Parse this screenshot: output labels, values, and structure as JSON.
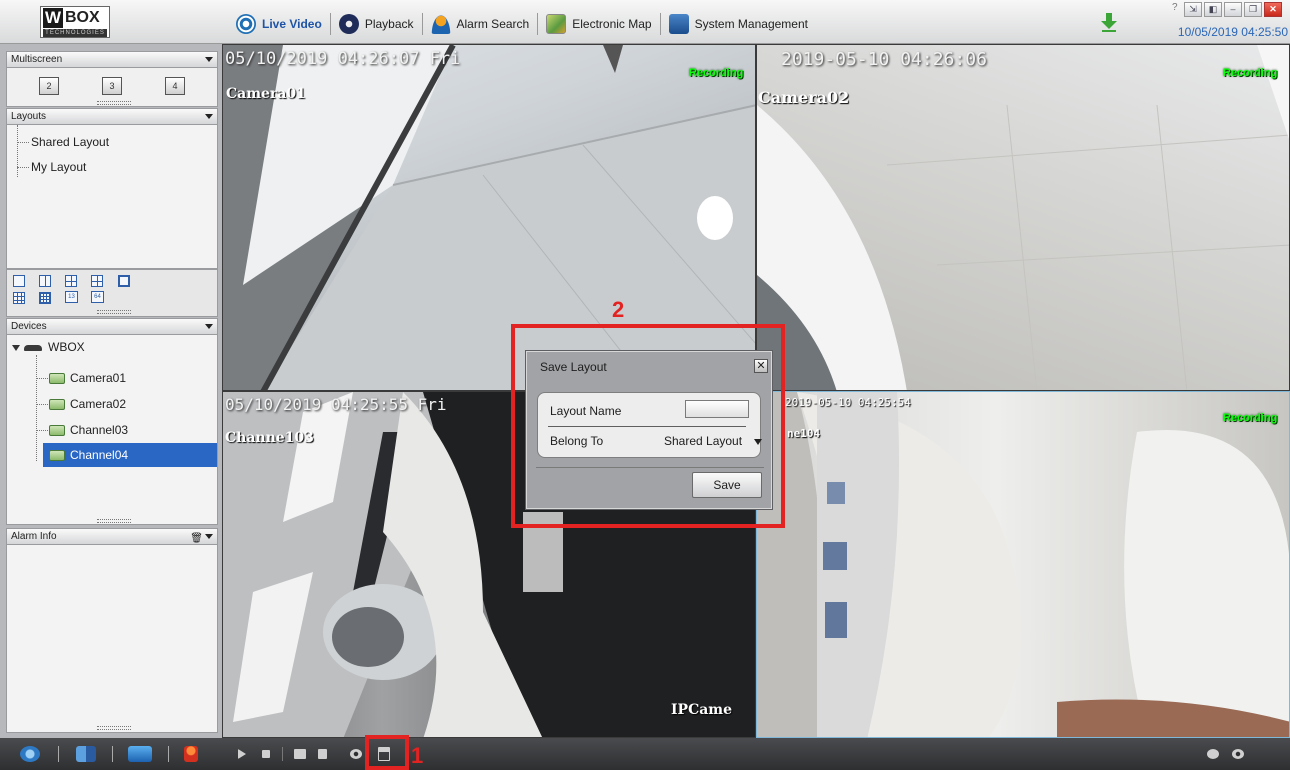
{
  "app": {
    "logo_letter": "W",
    "logo_word": "BOX",
    "logo_sub": "TECHNOLOGIES",
    "datetime": "10/05/2019 04:25:50",
    "question_mark": "?"
  },
  "nav": [
    {
      "label": "Live Video",
      "icon": "eye-icon",
      "active": true
    },
    {
      "label": "Playback",
      "icon": "playback-icon",
      "active": false
    },
    {
      "label": "Alarm Search",
      "icon": "alarm-search-icon",
      "active": false
    },
    {
      "label": "Electronic Map",
      "icon": "electronic-map-icon",
      "active": false
    },
    {
      "label": "System Management",
      "icon": "system-management-icon",
      "active": false
    }
  ],
  "sidebar": {
    "multiscreen": {
      "title": "Multiscreen",
      "buttons": [
        "2",
        "3",
        "4"
      ]
    },
    "layouts": {
      "title": "Layouts",
      "items": [
        "Shared Layout",
        "My Layout"
      ]
    },
    "devices": {
      "title": "Devices",
      "root": "WBOX",
      "items": [
        "Camera01",
        "Camera02",
        "Channel03",
        "Channel04"
      ],
      "selected": "Channel04"
    },
    "alarm_info": {
      "title": "Alarm Info"
    }
  },
  "layout_buttons": [
    "1",
    "2",
    "4",
    "6",
    "8",
    "9",
    "13",
    "16",
    "64"
  ],
  "tiles": [
    {
      "timestamp": "05/10/2019 04:26:07 Fri",
      "name": "Camera01",
      "status": "Recording"
    },
    {
      "timestamp": "2019-05-10 04:26:06",
      "name": "Camera02",
      "status": "Recording"
    },
    {
      "timestamp": "05/10/2019 04:25:55 Fri",
      "name": "Channe103",
      "bottom_label": "IPCame",
      "status": ""
    },
    {
      "timestamp": "2019-05-10 04:25:54",
      "name": "ne104",
      "status": "Recording"
    }
  ],
  "dialog": {
    "title": "Save Layout",
    "close": "✕",
    "layout_name_label": "Layout Name",
    "layout_name_value": "",
    "belong_to_label": "Belong To",
    "belong_to_value": "Shared Layout",
    "save_label": "Save"
  },
  "annotations": [
    {
      "number": "1",
      "color": "#e32222"
    },
    {
      "number": "2",
      "color": "#e32222"
    }
  ],
  "colors": {
    "accent": "#2a66c4",
    "recording": "#0aff0a",
    "annotation": "#e32222",
    "datetime": "#2a66b7"
  }
}
